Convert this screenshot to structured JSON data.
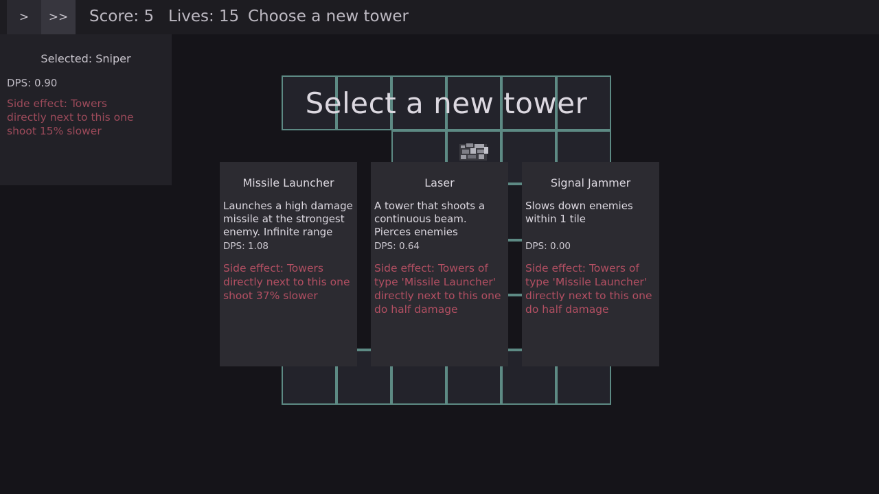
{
  "topbar": {
    "normal_speed_label": ">",
    "fast_speed_label": ">>",
    "score": "Score: 5",
    "lives": "Lives: 15",
    "message": "Choose a new tower"
  },
  "selected_panel": {
    "title": "Selected: Sniper",
    "dps": "DPS: 0.90",
    "side_effect": "Side effect: Towers directly next to this one shoot 15% slower"
  },
  "banner": {
    "title": "Select a new tower"
  },
  "cards": [
    {
      "title": "Missile Launcher",
      "description": "Launches a high damage missile at the strongest enemy. Infinite range",
      "dps": "DPS: 1.08",
      "side_effect": "Side effect: Towers directly next to this one shoot 37% slower"
    },
    {
      "title": "Laser",
      "description": "A tower that shoots a continuous beam. Pierces enemies",
      "dps": "DPS: 0.64",
      "side_effect": "Side effect: Towers of type 'Missile Launcher' directly next to this one do half damage"
    },
    {
      "title": "Signal Jammer",
      "description": "Slows down enemies within 1 tile",
      "dps": "DPS: 0.00",
      "side_effect": "Side effect: Towers of type 'Missile Launcher' directly next to this one do half damage"
    }
  ],
  "colors": {
    "background": "#151419",
    "panel": "#222127",
    "card": "#2c2b31",
    "grid_border": "#5d8a84",
    "side_effect_text": "#b24f62"
  },
  "icons": {
    "placed_tower": "sniper-tower-icon"
  }
}
